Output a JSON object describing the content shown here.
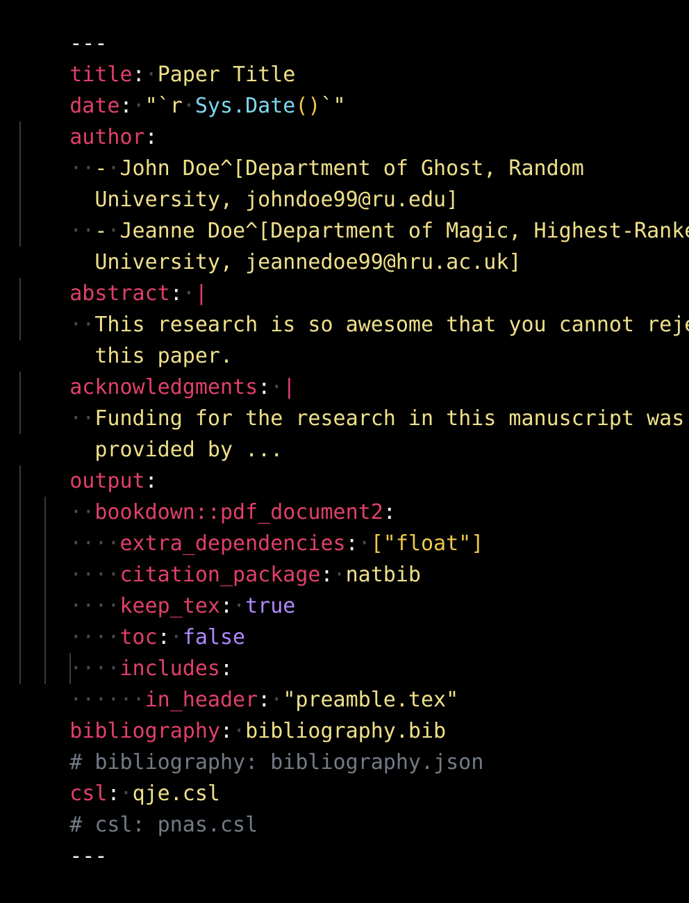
{
  "doc": {
    "fence_open": "---",
    "title": {
      "key": "title",
      "value": "Paper Title"
    },
    "date": {
      "key": "date",
      "quote_open": "\"`r",
      "func": "Sys.Date",
      "parens": "()",
      "quote_close": "`\""
    },
    "author": {
      "key": "author",
      "entries": [
        {
          "dash": "-",
          "line1": "John Doe^[Department of Ghost, Random",
          "line2": "University, johndoe99@ru.edu]"
        },
        {
          "dash": "-",
          "line1": "Jeanne Doe^[Department of Magic, Highest-Ranked",
          "line2": "University, jeannedoe99@hru.ac.uk]"
        }
      ]
    },
    "abstract": {
      "key": "abstract",
      "block": "|",
      "line1": "This research is so awesome that you cannot reject",
      "line2": "this paper."
    },
    "acknowledgments": {
      "key": "acknowledgments",
      "block": "|",
      "line1": "Funding for the research in this manuscript was",
      "line2": "provided by ..."
    },
    "output": {
      "key": "output",
      "format": "bookdown::pdf_document2",
      "extra_dependencies": {
        "key": "extra_dependencies",
        "value": "[\"float\"]"
      },
      "citation_package": {
        "key": "citation_package",
        "value": "natbib"
      },
      "keep_tex": {
        "key": "keep_tex",
        "value": "true"
      },
      "toc": {
        "key": "toc",
        "value": "false"
      },
      "includes": {
        "key": "includes"
      },
      "in_header": {
        "key": "in_header",
        "value": "\"preamble.tex\""
      }
    },
    "bibliography": {
      "key": "bibliography",
      "value": "bibliography.bib"
    },
    "bibliography_comment": "# bibliography: bibliography.json",
    "csl": {
      "key": "csl",
      "value": "qje.csl"
    },
    "csl_comment": "# csl: pnas.csl",
    "fence_close": "---"
  },
  "colors": {
    "background": "#000000",
    "key": "#e0406a",
    "string": "#efe08a",
    "function": "#7fd7ee",
    "bracket": "#efc84a",
    "boolean": "#b088ff",
    "comment": "#737b86"
  }
}
